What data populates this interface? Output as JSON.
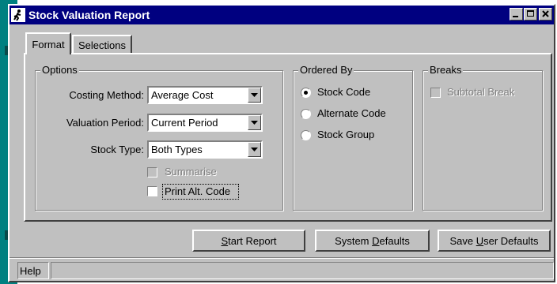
{
  "window": {
    "title": "Stock Valuation Report",
    "title_bg": "#000080",
    "face": "#c0c0c0"
  },
  "icons": {
    "app": "running-man-icon",
    "minimize": "minimize-icon",
    "maximize": "maximize-icon",
    "close": "close-icon",
    "dropdown": "chevron-down-icon"
  },
  "tabs": [
    {
      "label": "Format",
      "active": true
    },
    {
      "label": "Selections",
      "active": false
    }
  ],
  "options": {
    "group_label": "Options",
    "costing_method": {
      "label": "Costing Method:",
      "value": "Average Cost"
    },
    "valuation_period": {
      "label": "Valuation Period:",
      "value": "Current Period"
    },
    "stock_type": {
      "label": "Stock Type:",
      "value": "Both Types"
    },
    "summarise": {
      "label": "Summarise",
      "checked": false,
      "enabled": false
    },
    "print_alt_code": {
      "label": "Print Alt. Code",
      "checked": false,
      "enabled": true
    }
  },
  "ordered_by": {
    "group_label": "Ordered By",
    "options": [
      {
        "label": "Stock Code",
        "selected": true
      },
      {
        "label": "Alternate Code",
        "selected": false
      },
      {
        "label": "Stock Group",
        "selected": false
      }
    ]
  },
  "breaks": {
    "group_label": "Breaks",
    "subtotal_break": {
      "label": "Subtotal Break",
      "checked": false,
      "enabled": false
    }
  },
  "buttons": {
    "start_report": {
      "prefix": "",
      "accel": "S",
      "rest": "tart Report"
    },
    "system_defaults": {
      "prefix": "System ",
      "accel": "D",
      "rest": "efaults"
    },
    "save_user_defaults": {
      "prefix": "Save ",
      "accel": "U",
      "rest": "ser Defaults"
    }
  },
  "status": {
    "help": "Help",
    "message": ""
  }
}
